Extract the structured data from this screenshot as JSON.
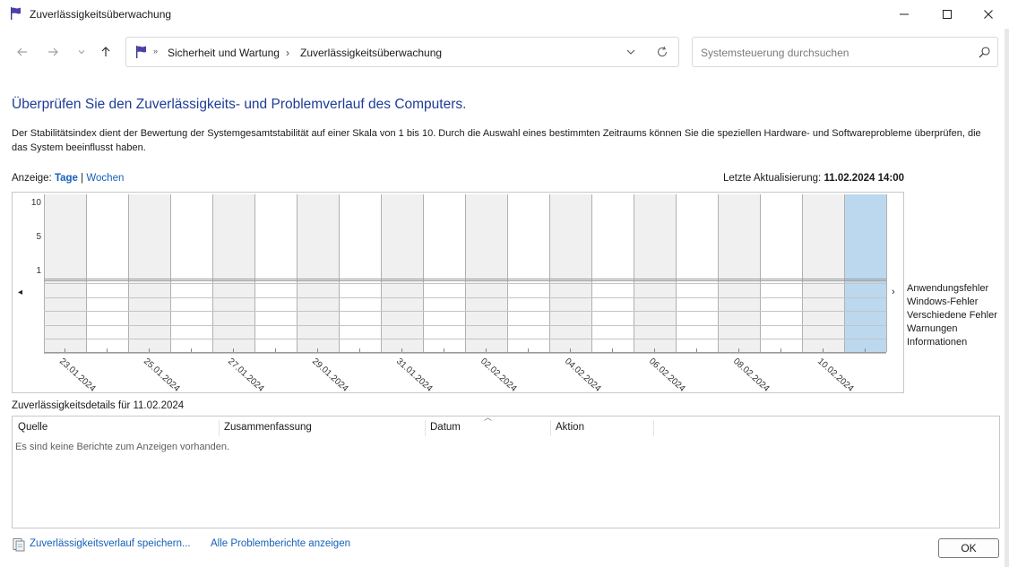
{
  "window": {
    "title": "Zuverlässigkeitsüberwachung"
  },
  "nav": {
    "breadcrumb": [
      "Sicherheit und Wartung",
      "Zuverlässigkeitsüberwachung"
    ],
    "search_placeholder": "Systemsteuerung durchsuchen"
  },
  "main": {
    "heading": "Überprüfen Sie den Zuverlässigkeits- und Problemverlauf des Computers.",
    "description": "Der Stabilitätsindex dient der Bewertung der Systemgesamtstabilität auf einer Skala von 1 bis 10. Durch die Auswahl eines bestimmten Zeitraums können Sie die speziellen Hardware- und Softwareprobleme überprüfen, die das System beeinflusst haben.",
    "view_label": "Anzeige:",
    "view_days": "Tage",
    "view_sep": "|",
    "view_weeks": "Wochen",
    "update_label": "Letzte Aktualisierung:",
    "update_value": "11.02.2024 14:00"
  },
  "chart_data": {
    "type": "table",
    "y_ticks": [
      "10",
      "5",
      "1"
    ],
    "columns": 20,
    "date_labels": [
      "23.01.2024",
      "25.01.2024",
      "27.01.2024",
      "29.01.2024",
      "31.01.2024",
      "02.02.2024",
      "04.02.2024",
      "06.02.2024",
      "08.02.2024",
      "10.02.2024"
    ],
    "selected_column": 19,
    "rows": [
      "Anwendungsfehler",
      "Windows-Fehler",
      "Verschiedene Fehler",
      "Warnungen",
      "Informationen"
    ],
    "colors": {
      "shaded": "#f0f0f0",
      "selected": "#bcd8ee",
      "grid": "#c8c8c8"
    }
  },
  "details": {
    "label": "Zuverlässigkeitsdetails für 11.02.2024",
    "columns": [
      "Quelle",
      "Zusammenfassung",
      "Datum",
      "Aktion"
    ],
    "empty_message": "Es sind keine Berichte zum Anzeigen vorhanden."
  },
  "footer": {
    "save_link": "Zuverlässigkeitsverlauf speichern...",
    "all_reports_link": "Alle Problemberichte anzeigen",
    "ok_label": "OK"
  }
}
